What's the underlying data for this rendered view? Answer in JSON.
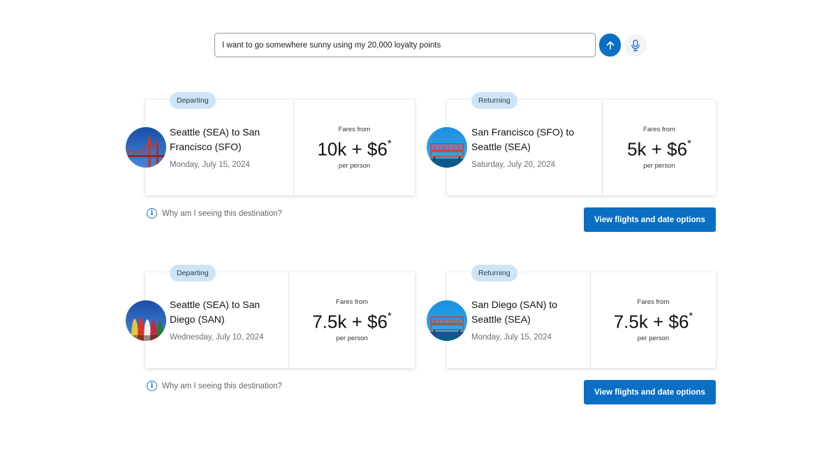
{
  "search": {
    "value": "I want to go somewhere sunny using my 20,000 loyalty points",
    "send_icon": "arrow-up-icon",
    "mic_icon": "microphone-icon"
  },
  "colors": {
    "accent": "#0b6fc4",
    "badge_bg": "#cde4f7"
  },
  "options": [
    {
      "departing": {
        "badge": "Departing",
        "route": "Seattle (SEA) to San Francisco (SFO)",
        "date": "Monday, July 15, 2024",
        "fares_label": "Fares from",
        "price": "10k + $6",
        "asterisk": "*",
        "per_person": "per person",
        "image": "golden-gate-bridge"
      },
      "returning": {
        "badge": "Returning",
        "route": "San Francisco (SFO) to Seattle (SEA)",
        "date": "Saturday, July 20, 2024",
        "fares_label": "Fares from",
        "price": "5k + $6",
        "asterisk": "*",
        "per_person": "per person",
        "image": "public-market-sign"
      },
      "why": "Why am I seeing this destination?",
      "cta": "View flights and date options"
    },
    {
      "departing": {
        "badge": "Departing",
        "route": "Seattle (SEA) to San Diego (SAN)",
        "date": "Wednesday, July 10, 2024",
        "fares_label": "Fares from",
        "price": "7.5k + $6",
        "asterisk": "*",
        "per_person": "per person",
        "image": "surfboards"
      },
      "returning": {
        "badge": "Returning",
        "route": "San Diego (SAN) to Seattle (SEA)",
        "date": "Monday, July 15, 2024",
        "fares_label": "Fares from",
        "price": "7.5k + $6",
        "asterisk": "*",
        "per_person": "per person",
        "image": "public-market-sign"
      },
      "why": "Why am I seeing this destination?",
      "cta": "View flights and date options"
    }
  ]
}
